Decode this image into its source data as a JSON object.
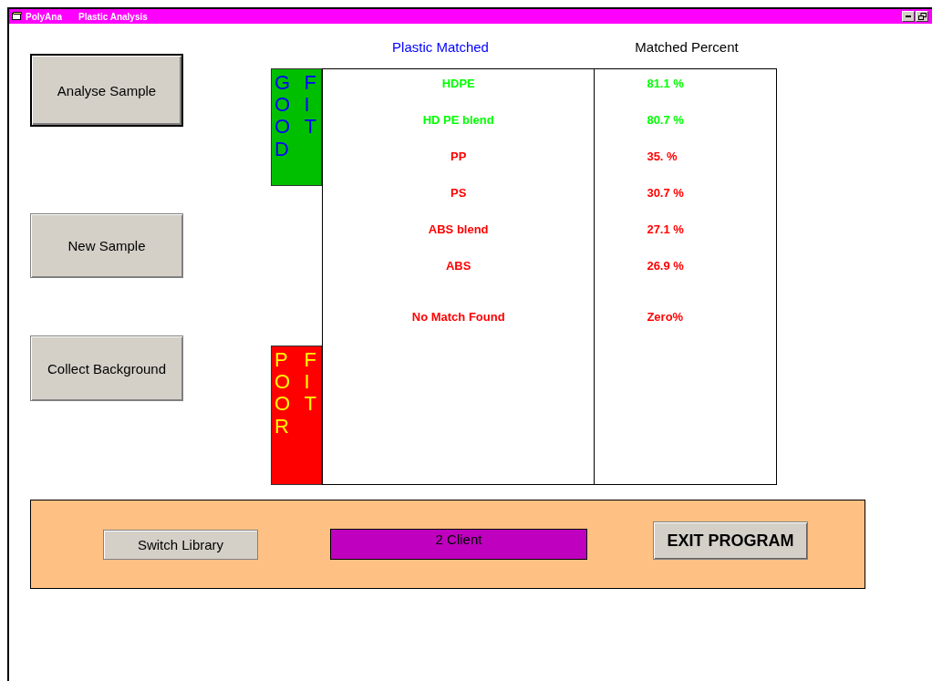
{
  "window": {
    "app": "PolyAna",
    "title": "Plastic Analysis"
  },
  "buttons": [
    {
      "label": "Analyse Sample",
      "focused": true
    },
    {
      "label": "New Sample",
      "focused": false
    },
    {
      "label": "Collect Background",
      "focused": false
    }
  ],
  "table": {
    "columns": [
      "Plastic Matched",
      "Matched Percent"
    ],
    "good_label": {
      "column_1": "GOOD",
      "column_2": "FIT"
    },
    "poor_label": {
      "column_1": "POOR",
      "column_2": "FIT"
    },
    "rows": [
      {
        "plastic": "HDPE",
        "percent": "81.1 %",
        "color": "#00ff00"
      },
      {
        "plastic": "HD PE blend",
        "percent": "80.7 %",
        "color": "#00ff00"
      },
      {
        "plastic": "PP",
        "percent": "35. %",
        "color": "#ff0000"
      },
      {
        "plastic": "PS",
        "percent": "30.7 %",
        "color": "#ff0000"
      },
      {
        "plastic": "ABS blend",
        "percent": "27.1 %",
        "color": "#ff0000"
      },
      {
        "plastic": "ABS",
        "percent": "26.9 %",
        "color": "#ff0000"
      },
      {
        "plastic": "No Match Found",
        "percent": "Zero%",
        "color": "#ff0000"
      }
    ]
  },
  "bottom_bar": {
    "switch_button": "Switch Library",
    "client": "2 Client",
    "exit_button": "EXIT PROGRAM"
  }
}
